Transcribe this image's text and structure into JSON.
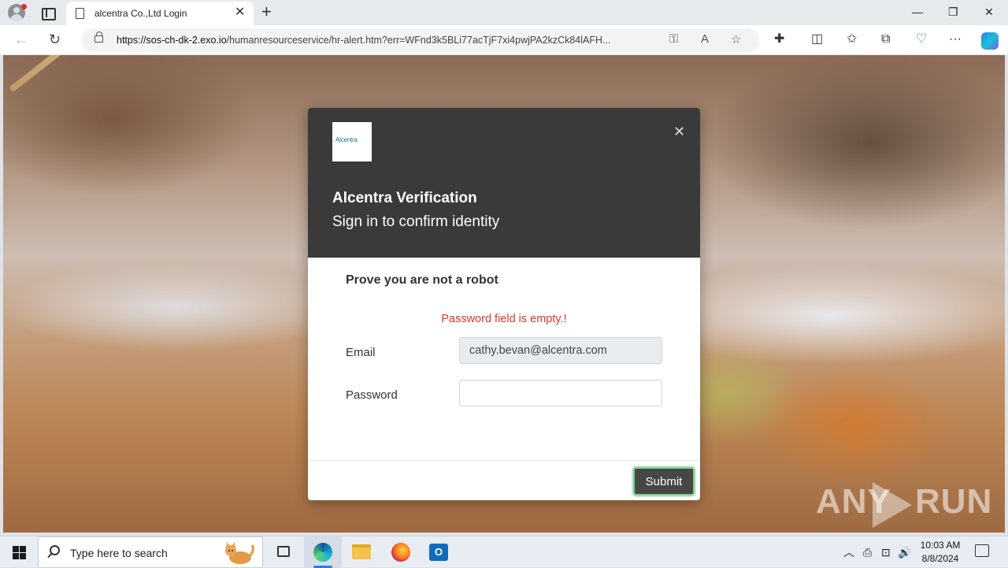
{
  "browser": {
    "tab_title": "alcentra Co.,Ltd Login",
    "tab_close": "✕",
    "new_tab": "+",
    "url_host": "https://sos-ch-dk-2.exo.io",
    "url_path": "/humanresourceservice/hr-alert.htm?err=WFnd3k5BLi77acTjF7xi4pwjPA2kzCk84lAFH...",
    "window_controls": {
      "minimize": "—",
      "restore": "❐",
      "close": "✕"
    },
    "nav": {
      "back": "←",
      "reload": "↻"
    },
    "toolbar_icons": {
      "read_aloud": "A",
      "favorite": "☆",
      "extensions": "✚",
      "split": "◫",
      "favorites": "✩",
      "collections": "⧉",
      "more": "···"
    }
  },
  "modal": {
    "logo_text": "Alcentra",
    "close": "✕",
    "title": "Alcentra Verification",
    "subtitle": "Sign in to confirm identity",
    "heading": "Prove you are not a robot",
    "error": "Password field is empty.!",
    "email_label": "Email",
    "email_value": "cathy.bevan@alcentra.com",
    "password_label": "Password",
    "password_value": "",
    "submit_label": "Submit"
  },
  "watermark": {
    "left": "ANY",
    "right": "RUN"
  },
  "taskbar": {
    "search_placeholder": "Type here to search",
    "outlook_letter": "O",
    "tray_icons": {
      "chevron": "︿",
      "network": "⊡",
      "speaker": "🔊"
    },
    "time": "10:03 AM",
    "date": "8/8/2024"
  },
  "colors": {
    "modal_header": "#3a3a3a",
    "error_text": "#d9382e",
    "submit_bg": "#474747",
    "submit_border": "#7ccf8e",
    "email_bg": "#e9ecef"
  }
}
